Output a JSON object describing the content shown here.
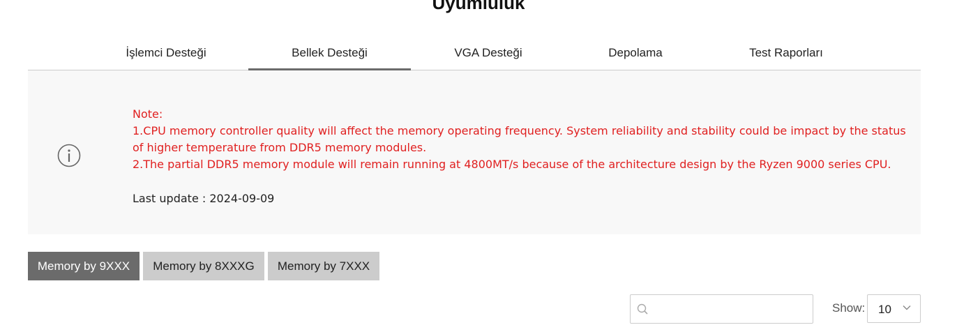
{
  "page": {
    "title": "Uyumluluk"
  },
  "tabs": [
    {
      "label": "İşlemci Desteği",
      "active": false
    },
    {
      "label": "Bellek Desteği",
      "active": true
    },
    {
      "label": "VGA Desteği",
      "active": false
    },
    {
      "label": "Depolama",
      "active": false
    },
    {
      "label": "Test Raporları",
      "active": false
    }
  ],
  "notice": {
    "icon": "info-icon",
    "note_heading": "Note:",
    "line1": "1.CPU memory controller quality will affect the memory operating frequency. System reliability and stability could be impact by the status of higher temperature from DDR5 memory modules.",
    "line2": "2.The partial DDR5 memory module will remain running at 4800MT/s because of the architecture design by the Ryzen 9000 series CPU.",
    "last_update": "Last update : 2024-09-09",
    "text_color": "#e02020",
    "background": "#f8f8f8"
  },
  "filters": [
    {
      "label": "Memory by 9XXX",
      "active": true
    },
    {
      "label": "Memory by 8XXXG",
      "active": false
    },
    {
      "label": "Memory by 7XXX",
      "active": false
    }
  ],
  "search": {
    "value": "",
    "icon": "search-icon"
  },
  "pagination": {
    "show_label": "Show:",
    "show_value": "10",
    "icon": "chevron-down-icon"
  },
  "colors": {
    "active_tab_underline": "#6b6b6b",
    "active_filter": "#6b6b6b",
    "inactive_filter": "#cccccc"
  }
}
